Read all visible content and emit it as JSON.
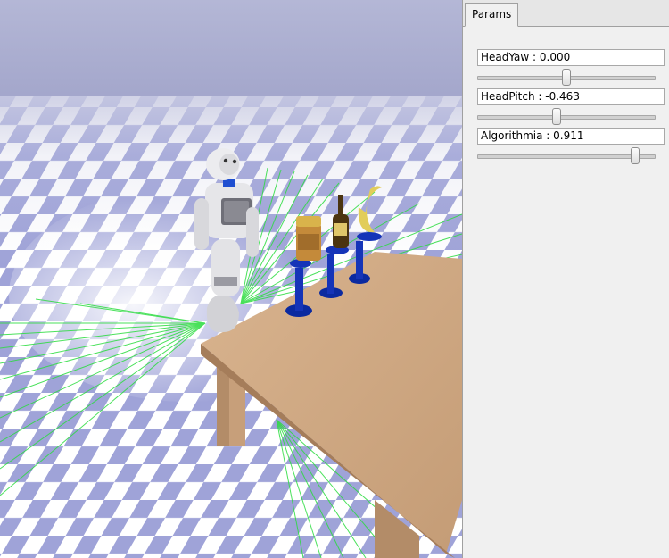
{
  "panel": {
    "tab_label": "Params",
    "params": [
      {
        "label": "HeadYaw : 0.000",
        "slider_fraction": 0.5
      },
      {
        "label": "HeadPitch : -0.463",
        "slider_fraction": 0.445
      },
      {
        "label": "Algorithmia : 0.911",
        "slider_fraction": 0.885
      }
    ]
  },
  "scene": {
    "sky_color": "#a7aacd",
    "floor_light": "#ffffff",
    "floor_dark": "#9fa3d8",
    "laser_color": "#2bdc3f",
    "table_color": "#c9a27e",
    "stand_color": "#0b2aa0",
    "objects": [
      "robot",
      "table",
      "cup",
      "bottle",
      "banana"
    ]
  }
}
